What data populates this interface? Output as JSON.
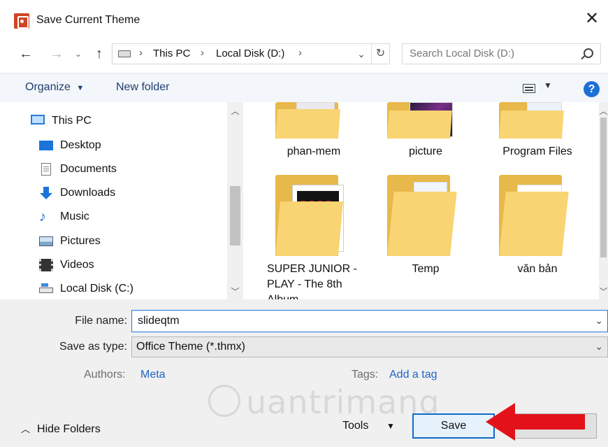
{
  "window": {
    "title": "Save Current Theme"
  },
  "address": {
    "crumbs": [
      "This PC",
      "Local Disk (D:)"
    ],
    "search_placeholder": "Search Local Disk (D:)"
  },
  "toolbar": {
    "organize_label": "Organize",
    "new_folder_label": "New folder",
    "help_label": "?"
  },
  "sidebar": {
    "items": [
      {
        "label": "This PC",
        "icon": "pc-icon"
      },
      {
        "label": "Desktop",
        "icon": "desktop-icon"
      },
      {
        "label": "Documents",
        "icon": "documents-icon"
      },
      {
        "label": "Downloads",
        "icon": "downloads-icon"
      },
      {
        "label": "Music",
        "icon": "music-icon"
      },
      {
        "label": "Pictures",
        "icon": "pictures-icon"
      },
      {
        "label": "Videos",
        "icon": "videos-icon"
      },
      {
        "label": "Local Disk (C:)",
        "icon": "local-disk-icon"
      }
    ]
  },
  "files": [
    {
      "name": "phan-mem"
    },
    {
      "name": "picture"
    },
    {
      "name": "Program Files"
    },
    {
      "name_lines": [
        "SUPER JUNIOR -",
        "PLAY - The 8th",
        "Album"
      ]
    },
    {
      "name": "Temp"
    },
    {
      "name": "văn bản"
    }
  ],
  "form": {
    "file_name_label": "File name:",
    "file_name_value": "slideqtm",
    "save_type_label": "Save as type:",
    "save_type_value": "Office Theme (*.thmx)",
    "authors_label": "Authors:",
    "authors_value": "Meta",
    "tags_label": "Tags:",
    "tags_value": "Add a tag"
  },
  "footer": {
    "hide_folders_label": "Hide Folders",
    "tools_label": "Tools",
    "save_label": "Save"
  },
  "watermark": "uantrimang",
  "colors": {
    "accent": "#1e7ad6",
    "folder": "#f8d472",
    "arrow": "#e3121a"
  }
}
